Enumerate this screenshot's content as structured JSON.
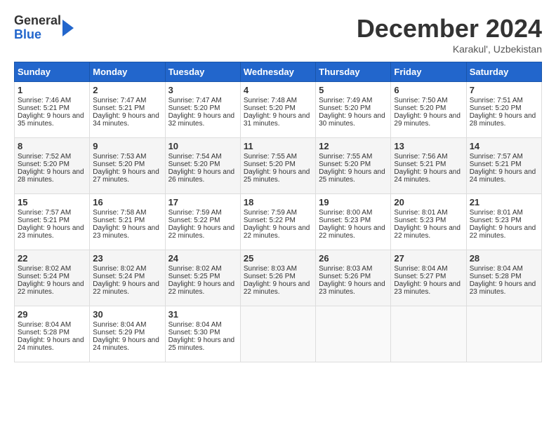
{
  "header": {
    "logo_line1": "General",
    "logo_line2": "Blue",
    "month": "December 2024",
    "location": "Karakul', Uzbekistan"
  },
  "weekdays": [
    "Sunday",
    "Monday",
    "Tuesday",
    "Wednesday",
    "Thursday",
    "Friday",
    "Saturday"
  ],
  "weeks": [
    [
      {
        "day": "1",
        "rise": "7:46 AM",
        "set": "5:21 PM",
        "hours": "9 hours and 35 minutes"
      },
      {
        "day": "2",
        "rise": "7:47 AM",
        "set": "5:21 PM",
        "hours": "9 hours and 34 minutes"
      },
      {
        "day": "3",
        "rise": "7:47 AM",
        "set": "5:20 PM",
        "hours": "9 hours and 32 minutes"
      },
      {
        "day": "4",
        "rise": "7:48 AM",
        "set": "5:20 PM",
        "hours": "9 hours and 31 minutes"
      },
      {
        "day": "5",
        "rise": "7:49 AM",
        "set": "5:20 PM",
        "hours": "9 hours and 30 minutes"
      },
      {
        "day": "6",
        "rise": "7:50 AM",
        "set": "5:20 PM",
        "hours": "9 hours and 29 minutes"
      },
      {
        "day": "7",
        "rise": "7:51 AM",
        "set": "5:20 PM",
        "hours": "9 hours and 28 minutes"
      }
    ],
    [
      {
        "day": "8",
        "rise": "7:52 AM",
        "set": "5:20 PM",
        "hours": "9 hours and 28 minutes"
      },
      {
        "day": "9",
        "rise": "7:53 AM",
        "set": "5:20 PM",
        "hours": "9 hours and 27 minutes"
      },
      {
        "day": "10",
        "rise": "7:54 AM",
        "set": "5:20 PM",
        "hours": "9 hours and 26 minutes"
      },
      {
        "day": "11",
        "rise": "7:55 AM",
        "set": "5:20 PM",
        "hours": "9 hours and 25 minutes"
      },
      {
        "day": "12",
        "rise": "7:55 AM",
        "set": "5:20 PM",
        "hours": "9 hours and 25 minutes"
      },
      {
        "day": "13",
        "rise": "7:56 AM",
        "set": "5:21 PM",
        "hours": "9 hours and 24 minutes"
      },
      {
        "day": "14",
        "rise": "7:57 AM",
        "set": "5:21 PM",
        "hours": "9 hours and 24 minutes"
      }
    ],
    [
      {
        "day": "15",
        "rise": "7:57 AM",
        "set": "5:21 PM",
        "hours": "9 hours and 23 minutes"
      },
      {
        "day": "16",
        "rise": "7:58 AM",
        "set": "5:21 PM",
        "hours": "9 hours and 23 minutes"
      },
      {
        "day": "17",
        "rise": "7:59 AM",
        "set": "5:22 PM",
        "hours": "9 hours and 22 minutes"
      },
      {
        "day": "18",
        "rise": "7:59 AM",
        "set": "5:22 PM",
        "hours": "9 hours and 22 minutes"
      },
      {
        "day": "19",
        "rise": "8:00 AM",
        "set": "5:23 PM",
        "hours": "9 hours and 22 minutes"
      },
      {
        "day": "20",
        "rise": "8:01 AM",
        "set": "5:23 PM",
        "hours": "9 hours and 22 minutes"
      },
      {
        "day": "21",
        "rise": "8:01 AM",
        "set": "5:23 PM",
        "hours": "9 hours and 22 minutes"
      }
    ],
    [
      {
        "day": "22",
        "rise": "8:02 AM",
        "set": "5:24 PM",
        "hours": "9 hours and 22 minutes"
      },
      {
        "day": "23",
        "rise": "8:02 AM",
        "set": "5:24 PM",
        "hours": "9 hours and 22 minutes"
      },
      {
        "day": "24",
        "rise": "8:02 AM",
        "set": "5:25 PM",
        "hours": "9 hours and 22 minutes"
      },
      {
        "day": "25",
        "rise": "8:03 AM",
        "set": "5:26 PM",
        "hours": "9 hours and 22 minutes"
      },
      {
        "day": "26",
        "rise": "8:03 AM",
        "set": "5:26 PM",
        "hours": "9 hours and 23 minutes"
      },
      {
        "day": "27",
        "rise": "8:04 AM",
        "set": "5:27 PM",
        "hours": "9 hours and 23 minutes"
      },
      {
        "day": "28",
        "rise": "8:04 AM",
        "set": "5:28 PM",
        "hours": "9 hours and 23 minutes"
      }
    ],
    [
      {
        "day": "29",
        "rise": "8:04 AM",
        "set": "5:28 PM",
        "hours": "9 hours and 24 minutes"
      },
      {
        "day": "30",
        "rise": "8:04 AM",
        "set": "5:29 PM",
        "hours": "9 hours and 24 minutes"
      },
      {
        "day": "31",
        "rise": "8:04 AM",
        "set": "5:30 PM",
        "hours": "9 hours and 25 minutes"
      },
      null,
      null,
      null,
      null
    ]
  ]
}
